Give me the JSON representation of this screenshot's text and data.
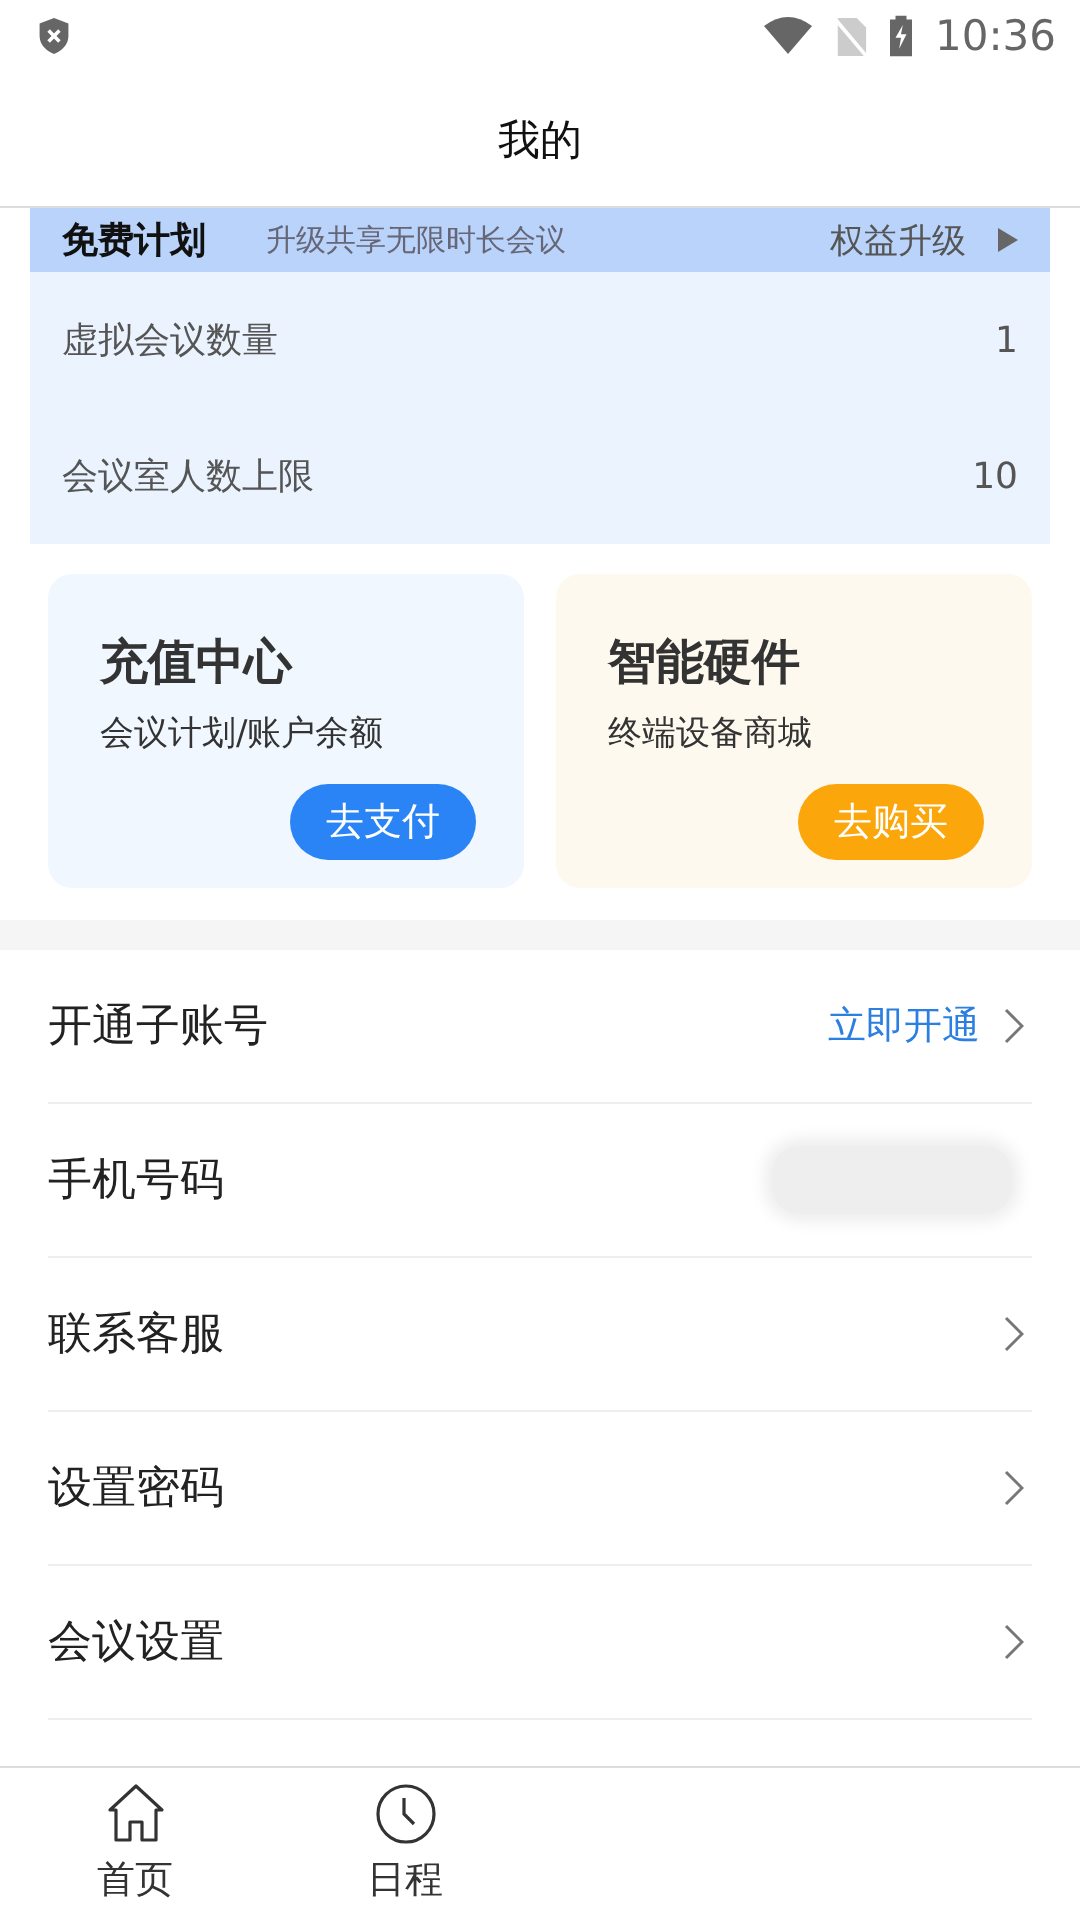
{
  "status_bar": {
    "time": "10:36"
  },
  "header": {
    "title": "我的"
  },
  "plan": {
    "name": "免费计划",
    "promo": "升级共享无限时长会议",
    "action": "权益升级"
  },
  "stats": [
    {
      "label": "虚拟会议数量",
      "value": "1"
    },
    {
      "label": "会议室人数上限",
      "value": "10"
    }
  ],
  "cards": [
    {
      "title": "充值中心",
      "subtitle": "会议计划/账户余额",
      "button": "去支付",
      "color": "#2b84f6"
    },
    {
      "title": "智能硬件",
      "subtitle": "终端设备商城",
      "button": "去购买",
      "color": "#fba70c"
    }
  ],
  "menu": [
    {
      "kind": "link",
      "label": "开通子账号",
      "value": "立即开通"
    },
    {
      "kind": "blurred",
      "label": "手机号码"
    },
    {
      "kind": "arrow",
      "label": "联系客服"
    },
    {
      "kind": "arrow",
      "label": "设置密码"
    },
    {
      "kind": "arrow",
      "label": "会议设置"
    }
  ],
  "tabs": [
    {
      "label": "首页",
      "kind": "home"
    },
    {
      "label": "日程",
      "kind": "schedule"
    }
  ]
}
